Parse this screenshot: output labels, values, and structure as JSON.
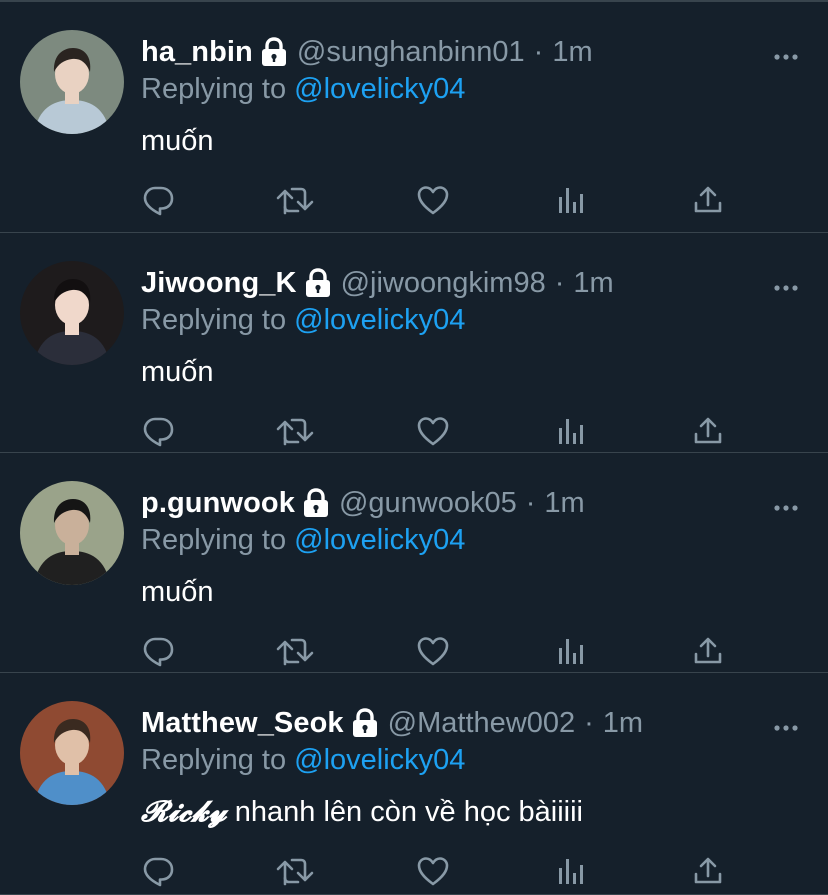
{
  "tweets": [
    {
      "display_name": "ha_nbin",
      "handle": "@sunghanbinn01",
      "separator": "·",
      "time": "1m",
      "replying_prefix": "Replying to ",
      "replying_to": "@lovelicky04",
      "text_prefix": "",
      "text": "muốn",
      "avatar": {
        "bg": "#7d8a7f",
        "shirt": "#b8c9d6",
        "hair": "#2a2420",
        "skin": "#e9d2c2"
      }
    },
    {
      "display_name": "Jiwoong_K",
      "handle": "@jiwoongkim98",
      "separator": "·",
      "time": "1m",
      "replying_prefix": "Replying to ",
      "replying_to": "@lovelicky04",
      "text_prefix": "",
      "text": "muốn",
      "avatar": {
        "bg": "#1e1b1c",
        "shirt": "#2b2e3a",
        "hair": "#120f10",
        "skin": "#f0d8cb"
      }
    },
    {
      "display_name": "p.gunwook",
      "handle": "@gunwook05",
      "separator": "·",
      "time": "1m",
      "replying_prefix": "Replying to ",
      "replying_to": "@lovelicky04",
      "text_prefix": "",
      "text": "muốn",
      "avatar": {
        "bg": "#9aa38a",
        "shirt": "#202020",
        "hair": "#151515",
        "skin": "#c9b09a"
      }
    },
    {
      "display_name": "Matthew_Seok",
      "handle": "@Matthew002",
      "separator": "·",
      "time": "1m",
      "replying_prefix": "Replying to ",
      "replying_to": "@lovelicky04",
      "text_prefix": "𝓡𝓲𝓬𝓴𝔂",
      "text": " nhanh lên còn về học bàiiiii",
      "avatar": {
        "bg": "#8f4a32",
        "shirt": "#4f8fc9",
        "hair": "#3a2a20",
        "skin": "#e0c0a8"
      }
    }
  ],
  "icons": {
    "reply": "reply-icon",
    "retweet": "retweet-icon",
    "like": "heart-icon",
    "analytics": "analytics-icon",
    "share": "share-icon",
    "lock": "lock-icon",
    "more": "more-icon"
  },
  "colors": {
    "background": "#15202b",
    "divider": "#38444d",
    "muted_text": "#8899a6",
    "mention": "#1da1f2",
    "text": "#ffffff"
  }
}
